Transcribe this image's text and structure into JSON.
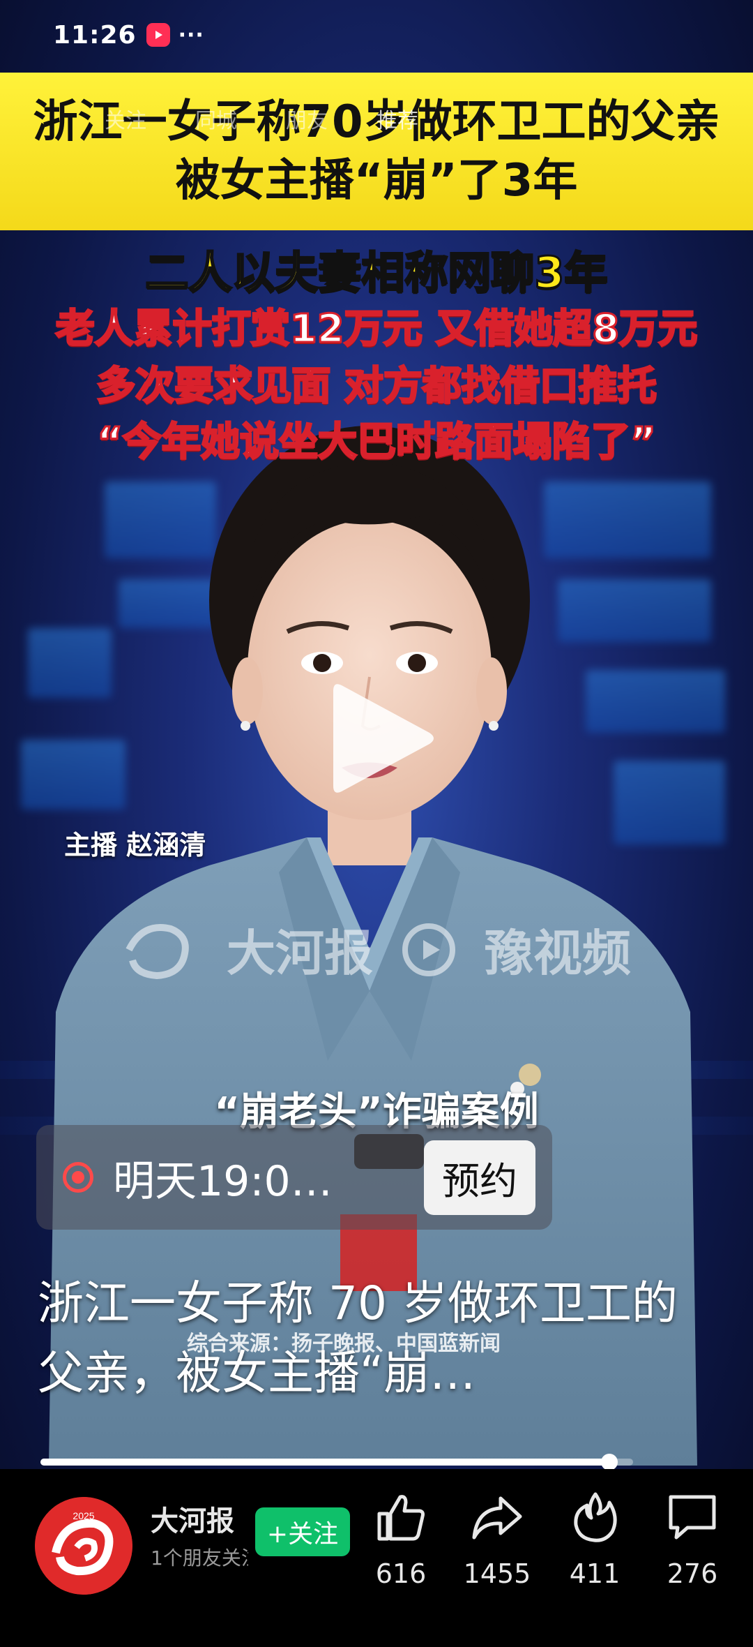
{
  "status_bar": {
    "time": "11:26",
    "more": "···"
  },
  "top_tabs": [
    {
      "label": "关注",
      "active": false
    },
    {
      "label": "同城",
      "active": false
    },
    {
      "label": "朋友",
      "active": false
    },
    {
      "label": "推荐",
      "active": true
    }
  ],
  "video": {
    "headline_line1": "浙江一女子称70岁做环卫工的父亲",
    "headline_line2": "被女主播“崩”了3年",
    "subtitle_1": "二人以夫妻相称网聊3年",
    "subtitle_2": "老人累计打赏12万元 又借她超8万元",
    "subtitle_3": "多次要求见面 对方都找借口推托",
    "subtitle_4": "“今年她说坐大巴时路面塌陷了”",
    "anchor_name": "主播 赵涵清",
    "watermark_left": "大河报",
    "watermark_right": "豫视频",
    "case_label": "“崩老头”诈骗案例",
    "source_note": "综合来源：扬子晚报、中国蓝新闻",
    "progress": 0.96
  },
  "reservation": {
    "text": "明天19:0…",
    "button": "预约"
  },
  "caption": "浙江一女子称 70 岁做环卫工的父亲，被女主播“崩…",
  "account": {
    "name": "大河报",
    "subtitle": "1个朋友关注",
    "follow_label": "+关注",
    "avatar_year": "2025"
  },
  "actions": [
    {
      "icon": "thumbs-up-icon",
      "count": "616"
    },
    {
      "icon": "share-icon",
      "count": "1455"
    },
    {
      "icon": "flame-icon",
      "count": "411"
    },
    {
      "icon": "comment-icon",
      "count": "276"
    }
  ],
  "colors": {
    "headline_bg": "#f4d91a",
    "accent_red": "#d9212c",
    "follow_green": "#0fc06a",
    "live_red": "#ff4a4a"
  }
}
